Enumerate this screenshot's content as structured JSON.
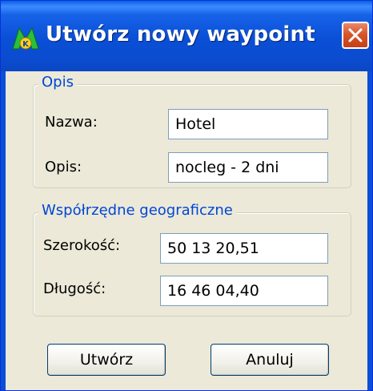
{
  "window": {
    "title": "Utwórz nowy waypoint",
    "icon": "app-logo-icon",
    "close_icon": "close-icon"
  },
  "groups": {
    "description": {
      "legend": "Opis",
      "name_label": "Nazwa:",
      "name_value": "Hotel",
      "desc_label": "Opis:",
      "desc_value": "nocleg - 2 dni"
    },
    "coordinates": {
      "legend": "Współrzędne geograficzne",
      "lat_label": "Szerokość:",
      "lat_value": "50 13 20,51",
      "lon_label": "Długość:",
      "lon_value": "16 46 04,40"
    }
  },
  "buttons": {
    "create_label": "Utwórz",
    "cancel_label": "Anuluj"
  },
  "colors": {
    "titlebar": "#0a4fd6",
    "legend_text": "#0046d5",
    "dialog_bg": "#ece9d8",
    "close_button": "#d8552b"
  }
}
